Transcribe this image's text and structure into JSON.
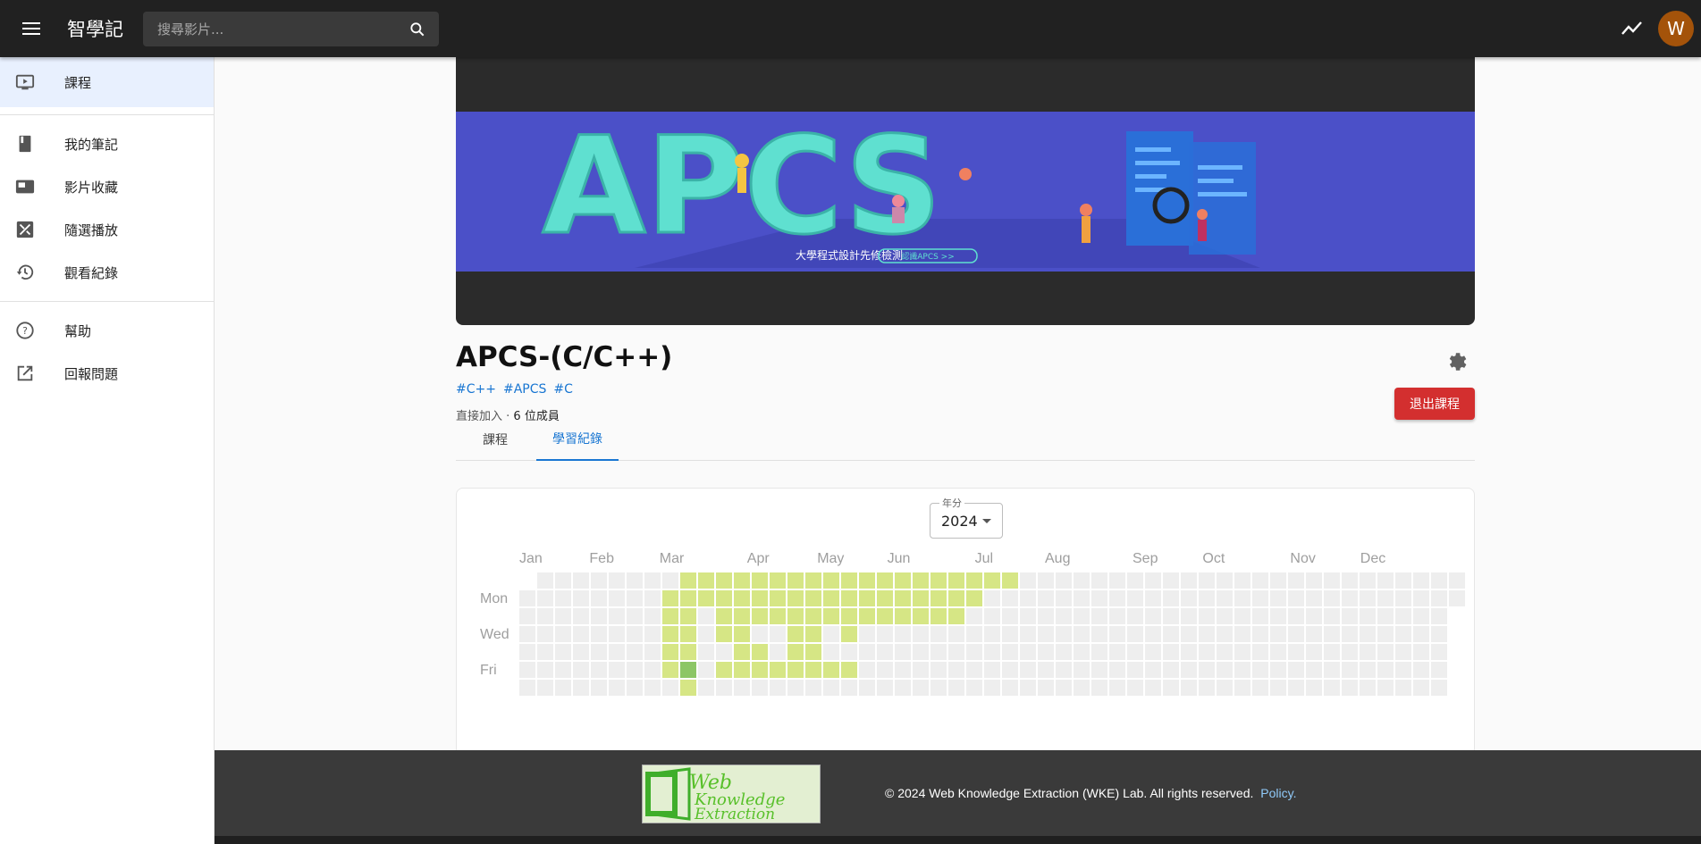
{
  "app": {
    "title": "智學記"
  },
  "search": {
    "placeholder": "搜尋影片..."
  },
  "user": {
    "avatar_letter": "W",
    "avatar_color": "#a4530a"
  },
  "sidebar": {
    "items": [
      {
        "label": "課程",
        "icon": "play-box-icon",
        "active": true
      },
      {
        "label": "我的筆記",
        "icon": "notebook-icon"
      },
      {
        "label": "影片收藏",
        "icon": "video-collection-icon"
      },
      {
        "label": "隨選播放",
        "icon": "shuffle-icon"
      },
      {
        "label": "觀看紀錄",
        "icon": "history-icon"
      },
      {
        "label": "幫助",
        "icon": "help-icon"
      },
      {
        "label": "回報問題",
        "icon": "open-external-icon"
      }
    ]
  },
  "banner": {
    "word": "APCS",
    "caption": "大學程式設計先修檢測",
    "cta": "認識APCS >>"
  },
  "course": {
    "title": "APCS-(C/C++)",
    "tags": [
      "#C++",
      "#APCS",
      "#C"
    ],
    "join_mode": "直接加入",
    "separator": " · ",
    "members": "6 位成員",
    "leave_label": "退出課程"
  },
  "tabs": [
    {
      "label": "課程",
      "active": false
    },
    {
      "label": "學習紀錄",
      "active": true
    }
  ],
  "activity": {
    "year_label": "年分",
    "year": "2024",
    "months": [
      "Jan",
      "Feb",
      "Mar",
      "Apr",
      "May",
      "Jun",
      "Jul",
      "Aug",
      "Sep",
      "Oct",
      "Nov",
      "Dec"
    ],
    "weekday_labels": [
      "Mon",
      "Wed",
      "Fri"
    ],
    "colors": {
      "empty": "#eeeeee",
      "low": "#d6e685",
      "mid": "#8cc665"
    },
    "levels": [
      "         1111111111111111111                    ",
      "        111111111111111111                       ",
      "        11 11111111111111                        ",
      "        11 11  11 1                              ",
      "        11  11 11                                ",
      "        12 11111111                              ",
      "         1                                       "
    ]
  },
  "footer": {
    "logo_text": [
      "Web",
      "Knowledge",
      "Extraction"
    ],
    "copyright": "© 2024 Web Knowledge Extraction (WKE) Lab. All rights reserved.",
    "policy": "Policy."
  }
}
